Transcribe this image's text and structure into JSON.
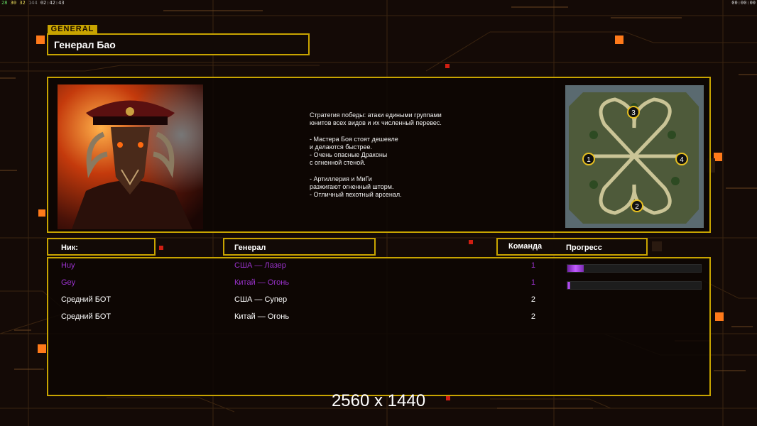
{
  "hud": {
    "left_fps": "28",
    "left_a": "30",
    "left_b": "32",
    "left_c": "144",
    "left_time": "02:42:43",
    "right_time": "00:00:00"
  },
  "colors": {
    "accent": "#c8a400",
    "player_purple": "#9a32cd",
    "progress_purple": "#c25cff",
    "background": "#140a06",
    "orange_square": "#ff7a1a"
  },
  "general_tag": "GENERAL",
  "general_name": "Генерал Бао",
  "description": "Стратегия победы: атаки едиными группами\nюнитов всех видов и их численный перевес.\n\n- Мастера Боя стоят дешевле\nи делаются быстрее.\n- Очень опасные Драконы\nс огненной стеной.\n\n- Артиллерия и МиГи\nразжигают огненный шторм.\n- Отличный пехотный арсенал.",
  "map_positions": [
    "1",
    "2",
    "3",
    "4"
  ],
  "columns": {
    "nick": "Ник:",
    "general": "Генерал",
    "team": "Команда",
    "progress": "Прогресс"
  },
  "players": [
    {
      "nick": "Huy",
      "general": "США — Лазер",
      "team": "1",
      "color": "#9a32cd",
      "progress": 0.12
    },
    {
      "nick": "Gey",
      "general": "Китай — Огонь",
      "team": "1",
      "color": "#9a32cd",
      "progress": 0.02
    },
    {
      "nick": "Средний БОТ",
      "general": "США — Супер",
      "team": "2",
      "color": "#ffffff",
      "progress": null
    },
    {
      "nick": "Средний БОТ",
      "general": "Китай — Огонь",
      "team": "2",
      "color": "#ffffff",
      "progress": null
    }
  ],
  "resolution": "2560 x 1440"
}
